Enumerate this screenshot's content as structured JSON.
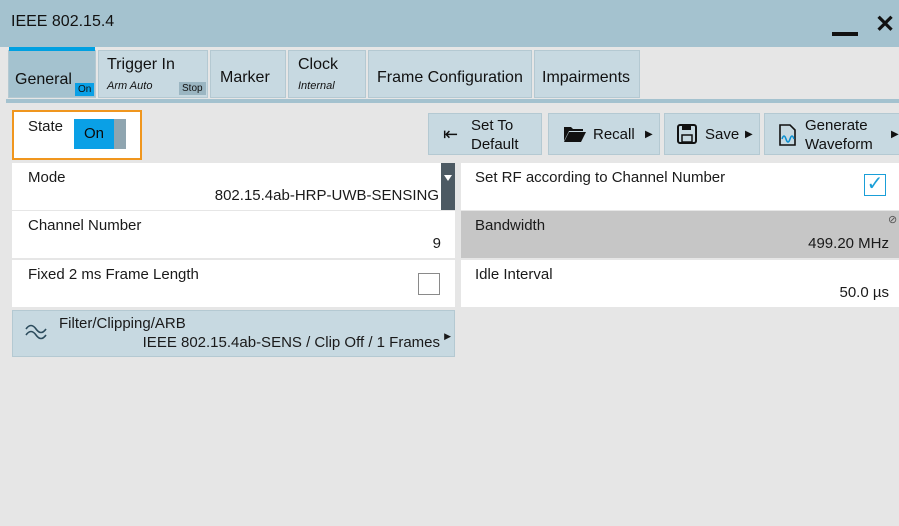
{
  "window": {
    "title": "IEEE 802.15.4",
    "minimize_label": "",
    "close_label": "✕"
  },
  "tabs": [
    {
      "label": "General",
      "badge": "On"
    },
    {
      "label": "Trigger In",
      "sub": "Arm Auto",
      "badge": "Stop"
    },
    {
      "label": "Marker"
    },
    {
      "label": "Clock",
      "sub": "Internal"
    },
    {
      "label": "Frame Configuration"
    },
    {
      "label": "Impairments"
    }
  ],
  "state": {
    "label": "State",
    "value": "On"
  },
  "toolbar": {
    "set_default": {
      "line1": "Set To",
      "line2": "Default",
      "icon": "set-to-default-icon"
    },
    "recall": {
      "label": "Recall",
      "icon": "folder-open-icon"
    },
    "save": {
      "label": "Save",
      "icon": "floppy-disk-icon"
    },
    "generate": {
      "line1": "Generate",
      "line2": "Waveform",
      "icon": "generate-waveform-icon"
    }
  },
  "fields": {
    "mode": {
      "label": "Mode",
      "value": "802.15.4ab-HRP-UWB-SENSING"
    },
    "set_rf": {
      "label": "Set RF according to Channel Number",
      "checked": true
    },
    "channel_number": {
      "label": "Channel Number",
      "value": "9"
    },
    "bandwidth": {
      "label": "Bandwidth",
      "value": "499.20 MHz"
    },
    "fixed_frame": {
      "label": "Fixed 2 ms Frame Length",
      "checked": false
    },
    "idle_interval": {
      "label": "Idle Interval",
      "value": "50.0 µs"
    }
  },
  "filter": {
    "label": "Filter/Clipping/ARB",
    "value": "IEEE 802.15.4ab-SENS / Clip Off / 1 Frames"
  },
  "colors": {
    "accent": "#00a0e1",
    "highlight": "#f0961e",
    "tab_bg": "#c7d9e1",
    "titlebar": "#a4c2cf"
  }
}
